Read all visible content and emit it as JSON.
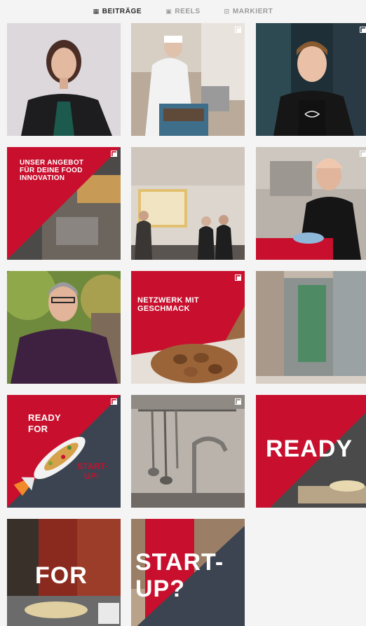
{
  "tabs": [
    {
      "label": "BEITRÄGE",
      "icon": "grid-icon",
      "active": true
    },
    {
      "label": "REELS",
      "icon": "reels-icon",
      "active": false
    },
    {
      "label": "MARKIERT",
      "icon": "tagged-icon",
      "active": false
    }
  ],
  "posts": {
    "p4": {
      "text": "UNSER ANGEBOT FÜR DEINE FOOD INNOVATION"
    },
    "p8": {
      "text": "NETZWERK MIT GESCHMACK"
    },
    "p10": {
      "line1": "READY",
      "line2": "FOR",
      "line3": "START-",
      "line4": "UP!"
    },
    "p12": {
      "text": "READY"
    },
    "p13": {
      "text": "FOR"
    },
    "p14": {
      "line1": "START-",
      "line2": "UP?"
    }
  },
  "colors": {
    "brand_red": "#c8102e",
    "dark_slate": "#3b4450"
  }
}
